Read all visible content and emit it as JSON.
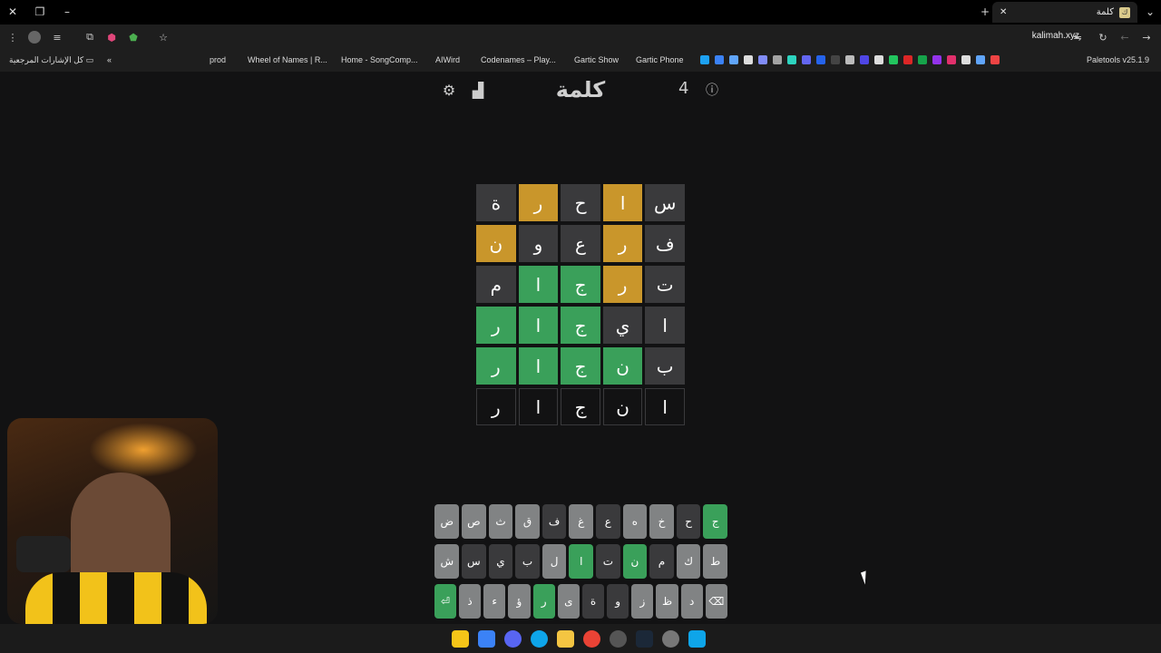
{
  "browser": {
    "tab_title": "كلمة",
    "url": "kalimah.xyz"
  },
  "bookmarks": {
    "all_bookmarks": "كل الإشارات المرجعية",
    "items": [
      "prod",
      "Wheel of Names | R...",
      "Home - SongComp...",
      "AIWird",
      "Codenames – Play...",
      "Gartic Show",
      "Gartic Phone",
      "Paletools v25.1.9"
    ]
  },
  "game": {
    "title": "كلمة",
    "streak": "4",
    "board": [
      [
        {
          "l": "س",
          "s": "absent"
        },
        {
          "l": "ا",
          "s": "present"
        },
        {
          "l": "ح",
          "s": "absent"
        },
        {
          "l": "ر",
          "s": "present"
        },
        {
          "l": "ة",
          "s": "absent"
        }
      ],
      [
        {
          "l": "ف",
          "s": "absent"
        },
        {
          "l": "ر",
          "s": "present"
        },
        {
          "l": "ع",
          "s": "absent"
        },
        {
          "l": "و",
          "s": "absent"
        },
        {
          "l": "ن",
          "s": "present"
        }
      ],
      [
        {
          "l": "ت",
          "s": "absent"
        },
        {
          "l": "ر",
          "s": "present"
        },
        {
          "l": "ج",
          "s": "correct"
        },
        {
          "l": "ا",
          "s": "correct"
        },
        {
          "l": "م",
          "s": "absent"
        }
      ],
      [
        {
          "l": "ا",
          "s": "absent"
        },
        {
          "l": "ي",
          "s": "absent"
        },
        {
          "l": "ج",
          "s": "correct"
        },
        {
          "l": "ا",
          "s": "correct"
        },
        {
          "l": "ر",
          "s": "correct"
        }
      ],
      [
        {
          "l": "ب",
          "s": "absent"
        },
        {
          "l": "ن",
          "s": "correct"
        },
        {
          "l": "ج",
          "s": "correct"
        },
        {
          "l": "ا",
          "s": "correct"
        },
        {
          "l": "ر",
          "s": "correct"
        }
      ],
      [
        {
          "l": "ا",
          "s": "empty"
        },
        {
          "l": "ن",
          "s": "empty"
        },
        {
          "l": "ج",
          "s": "empty"
        },
        {
          "l": "ا",
          "s": "empty"
        },
        {
          "l": "ر",
          "s": "empty"
        }
      ]
    ],
    "keyboard": [
      [
        {
          "k": "ج",
          "s": "correct"
        },
        {
          "k": "ح",
          "s": "absent"
        },
        {
          "k": "خ",
          "s": "unused"
        },
        {
          "k": "ه",
          "s": "unused"
        },
        {
          "k": "ع",
          "s": "absent"
        },
        {
          "k": "غ",
          "s": "unused"
        },
        {
          "k": "ف",
          "s": "absent"
        },
        {
          "k": "ق",
          "s": "unused"
        },
        {
          "k": "ث",
          "s": "unused"
        },
        {
          "k": "ص",
          "s": "unused"
        },
        {
          "k": "ض",
          "s": "unused"
        }
      ],
      [
        {
          "k": "ط",
          "s": "unused"
        },
        {
          "k": "ك",
          "s": "unused"
        },
        {
          "k": "م",
          "s": "absent"
        },
        {
          "k": "ن",
          "s": "correct"
        },
        {
          "k": "ت",
          "s": "absent"
        },
        {
          "k": "ا",
          "s": "correct"
        },
        {
          "k": "ل",
          "s": "unused"
        },
        {
          "k": "ب",
          "s": "absent"
        },
        {
          "k": "ي",
          "s": "absent"
        },
        {
          "k": "س",
          "s": "absent"
        },
        {
          "k": "ش",
          "s": "unused"
        }
      ],
      [
        {
          "k": "⌫",
          "s": "unused"
        },
        {
          "k": "د",
          "s": "unused"
        },
        {
          "k": "ظ",
          "s": "unused"
        },
        {
          "k": "ز",
          "s": "unused"
        },
        {
          "k": "و",
          "s": "absent"
        },
        {
          "k": "ة",
          "s": "absent"
        },
        {
          "k": "ى",
          "s": "unused"
        },
        {
          "k": "ر",
          "s": "correct"
        },
        {
          "k": "ؤ",
          "s": "unused"
        },
        {
          "k": "ء",
          "s": "unused"
        },
        {
          "k": "ذ",
          "s": "unused"
        },
        {
          "k": "⏎",
          "s": "correct"
        }
      ]
    ]
  },
  "colors": {
    "correct": "#3aa05a",
    "present": "#c9962b",
    "absent": "#3a3a3c"
  }
}
